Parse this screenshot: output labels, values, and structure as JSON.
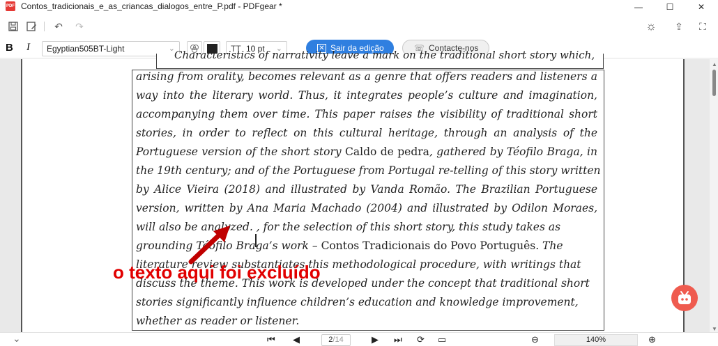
{
  "window": {
    "title": "Contos_tradicionais_e_as_criancas_dialogos_entre_P.pdf - PDFgear *",
    "logo_text": "PDF",
    "minimize": "—",
    "maximize": "☐",
    "close": "✕"
  },
  "toolbar": {
    "save_icon": "💾",
    "save_as_icon": "🖫",
    "undo_icon": "↶",
    "redo_icon": "↷",
    "theme_icon": "☼",
    "share_icon": "⇪",
    "fullscreen_icon": "⛶"
  },
  "format": {
    "bold": "B",
    "italic": "I",
    "font_name": "Egyptian505BT-Light",
    "font_size": "10 pt",
    "text_color": "#222222",
    "size_icon": "TT"
  },
  "buttons": {
    "exit_edit": "Sair da edição",
    "contact": "Contacte-nos"
  },
  "document": {
    "heading_fragment": "Characteristics of narrativity leave a mark on the traditional short story which,",
    "lines": [
      {
        "parts": [
          {
            "t": "arising from orality, becomes relevant as a genre that offers readers and listeners a",
            "i": true
          }
        ],
        "justify": true
      },
      {
        "parts": [
          {
            "t": "way into the literary world. Thus, it integrates people’s culture and imagination,",
            "i": true
          }
        ],
        "justify": true
      },
      {
        "parts": [
          {
            "t": "accompanying them over time. This paper raises the visibility of traditional short",
            "i": true
          }
        ],
        "justify": true
      },
      {
        "parts": [
          {
            "t": "stories, in order to reflect on this cultural heritage, through an analysis of the",
            "i": true
          }
        ],
        "justify": true
      },
      {
        "parts": [
          {
            "t": "Portuguese version of the short story ",
            "i": true
          },
          {
            "t": "Caldo de pedra",
            "i": false
          },
          {
            "t": ", gathered by Téofilo Braga, in",
            "i": true
          }
        ],
        "justify": true
      },
      {
        "parts": [
          {
            "t": "the 19th century; and of the Portuguese from Portugal re-telling of this story written",
            "i": true
          }
        ],
        "justify": true
      },
      {
        "parts": [
          {
            "t": "by Alice Vieira (2018) and illustrated by Vanda Romão. The Brazilian Portuguese",
            "i": true
          }
        ],
        "justify": true
      },
      {
        "parts": [
          {
            "t": "version, written by Ana Maria Machado (2004) and illustrated by Odilon Moraes,",
            "i": true
          }
        ],
        "justify": true
      },
      {
        "parts": [
          {
            "t": "will also be analyzed.  , for the selection of this  short story, this study takes as",
            "i": true
          }
        ],
        "justify": false
      },
      {
        "parts": [
          {
            "t": "grounding Téofilo Braga’s work – ",
            "i": true
          },
          {
            "t": "Contos Tradicionais do Povo Português",
            "i": false
          },
          {
            "t": ". The",
            "i": true
          }
        ],
        "justify": false
      },
      {
        "parts": [
          {
            "t": "literature review substantiates this methodological procedure,  with writings that",
            "i": true
          }
        ],
        "justify": false
      },
      {
        "parts": [
          {
            "t": "discuss the theme. This work is developed under the concept that  traditional short",
            "i": true
          }
        ],
        "justify": false
      },
      {
        "parts": [
          {
            "t": "stories significantly influence children’s education and knowledge  improvement,",
            "i": true
          }
        ],
        "justify": false
      },
      {
        "parts": [
          {
            "t": "whether as reader or listener.",
            "i": true
          }
        ],
        "justify": false
      }
    ],
    "annotation": "o texto aqui foi excluído",
    "annotation_color": "#e10000"
  },
  "bottom": {
    "current_page": "2",
    "total_pages": "/14",
    "zoom": "140%",
    "first_icon": "⏮",
    "prev_icon": "◀",
    "next_icon": "▶",
    "last_icon": "⏭",
    "zoom_out_icon": "⊖",
    "zoom_in_icon": "⊕",
    "collapse_icon": "⌄"
  },
  "colors": {
    "accent": "#2f7fe0",
    "bot_badge": "#ef5b4f"
  }
}
